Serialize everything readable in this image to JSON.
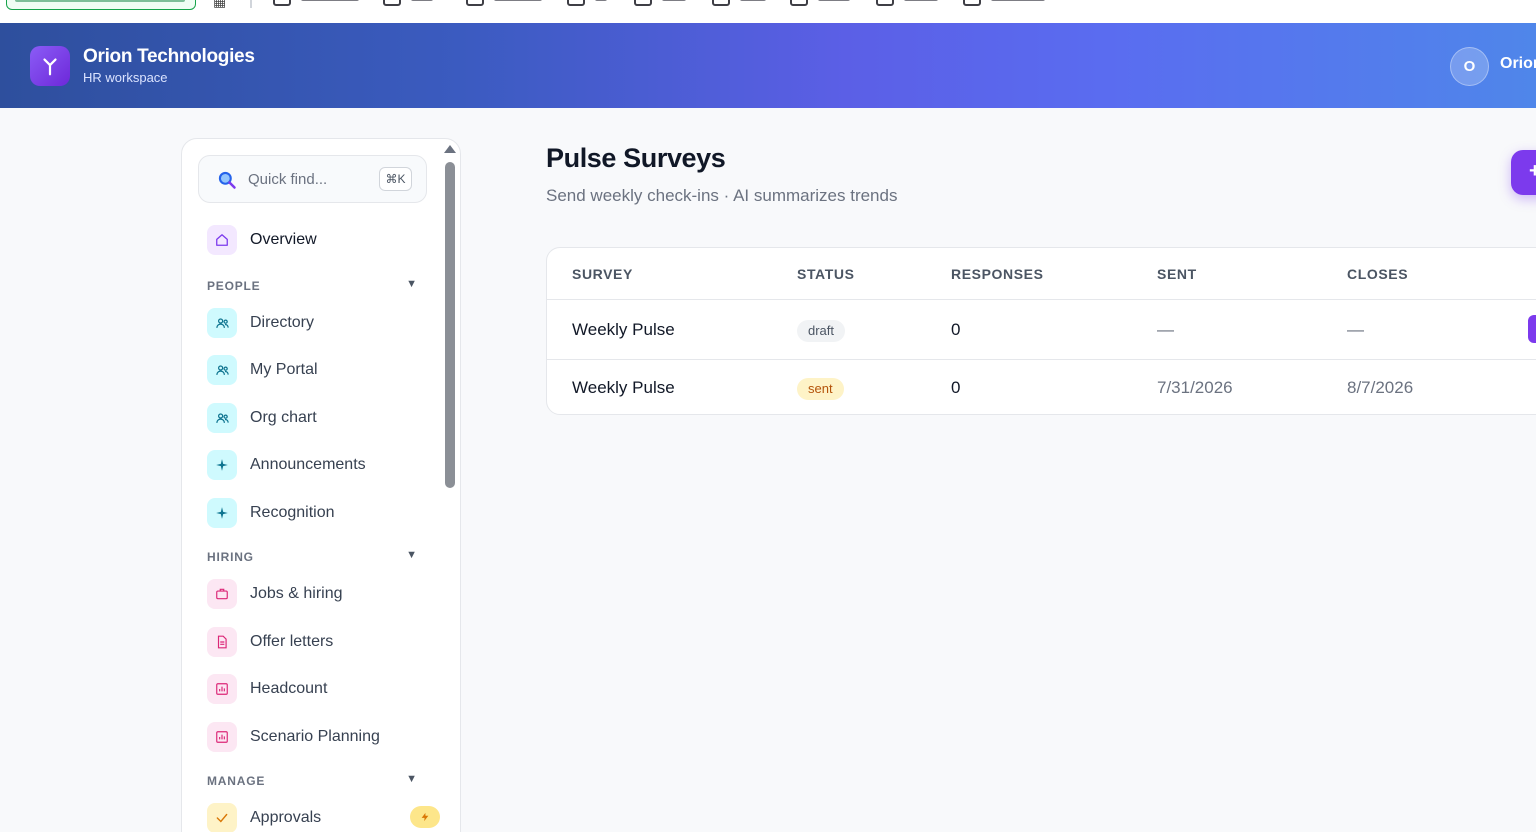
{
  "header": {
    "org_name": "Orion Technologies",
    "org_subtitle": "HR workspace",
    "user_initial": "O",
    "user_name": "Orion"
  },
  "sidebar": {
    "search_placeholder": "Quick find...",
    "search_shortcut": "⌘K",
    "overview": "Overview",
    "sections": [
      {
        "title": "PEOPLE",
        "items": [
          "Directory",
          "My Portal",
          "Org chart",
          "Announcements",
          "Recognition"
        ]
      },
      {
        "title": "HIRING",
        "items": [
          "Jobs & hiring",
          "Offer letters",
          "Headcount",
          "Scenario Planning"
        ]
      },
      {
        "title": "MANAGE",
        "items": [
          "Approvals"
        ]
      }
    ]
  },
  "main": {
    "title": "Pulse Surveys",
    "subtitle": "Send weekly check-ins · AI summarizes trends",
    "table": {
      "columns": [
        "SURVEY",
        "STATUS",
        "RESPONSES",
        "SENT",
        "CLOSES"
      ],
      "rows": [
        {
          "survey": "Weekly Pulse",
          "status": "draft",
          "responses": "0",
          "sent": "—",
          "closes": "—"
        },
        {
          "survey": "Weekly Pulse",
          "status": "sent",
          "responses": "0",
          "sent": "7/31/2026",
          "closes": "8/7/2026"
        }
      ]
    }
  },
  "colors": {
    "accent": "#7c3aed",
    "header_start": "#2e4f9d",
    "header_mid": "#5b5fe6",
    "header_end": "#4f86ea",
    "status_draft_bg": "#f1f3f5",
    "status_sent_bg": "#fef3c7",
    "status_sent_text": "#b45309"
  },
  "icons": {
    "logo": "flower-icon",
    "search": "search-icon",
    "overview": "home-icon",
    "people": "users-icon",
    "engagement": "sparkle-icon",
    "jobs": "briefcase-icon",
    "offer": "document-icon",
    "chart": "chart-icon",
    "approvals": "check-icon",
    "badge": "bolt-icon"
  }
}
